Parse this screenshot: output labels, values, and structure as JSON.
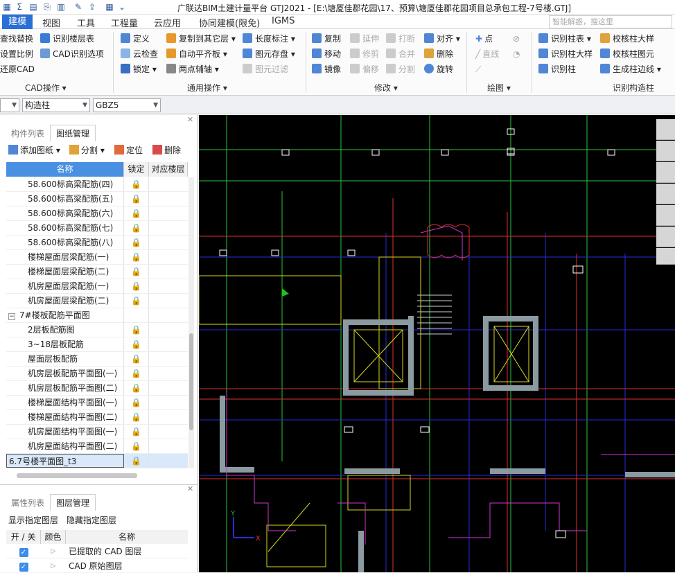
{
  "app": {
    "title": "广联达BIM土建计量平台 GTJ2021 - [E:\\塘厦佳郡花园\\17、预算\\塘厦佳郡花园项目总承包工程-7号楼.GTJ]",
    "search_placeholder": "智能解惑，搜这里"
  },
  "menu": [
    "建模",
    "视图",
    "工具",
    "工程量",
    "云应用",
    "协同建模(限免)",
    "IGMS"
  ],
  "ribbon": {
    "cad_ops": {
      "items": [
        "查找替换",
        "识别楼层表",
        "设置比例",
        "CAD识别选项",
        "还原CAD"
      ],
      "group": "CAD操作"
    },
    "general_ops": {
      "items": [
        "定义",
        "复制到其它层",
        "长度标注",
        "云检查",
        "自动平齐板",
        "图元存盘",
        "锁定",
        "两点辅轴",
        "图元过滤"
      ],
      "group": "通用操作"
    },
    "modify": {
      "items": [
        "复制",
        "延伸",
        "打断",
        "对齐",
        "移动",
        "修剪",
        "合并",
        "删除",
        "镜像",
        "偏移",
        "分割",
        "旋转"
      ],
      "group": "修改"
    },
    "draw": {
      "items": [
        "点",
        "直线"
      ],
      "group": "绘图"
    },
    "recognize": {
      "items": [
        "识别柱表",
        "校核柱大样",
        "识别柱大样",
        "校核柱图元",
        "识别柱",
        "生成柱边线"
      ],
      "group": "识别构造柱"
    }
  },
  "selectors": {
    "floor": "",
    "type": "构造柱",
    "name": "GBZ5"
  },
  "left_panel": {
    "tabs": [
      "构件列表",
      "图纸管理"
    ],
    "toolbar": [
      "添加图纸",
      "分割",
      "定位",
      "删除"
    ],
    "columns": [
      "名称",
      "锁定",
      "对应楼层"
    ],
    "rows": [
      "58.600标高梁配筋(四)",
      "58.600标高梁配筋(五)",
      "58.600标高梁配筋(六)",
      "58.600标高梁配筋(七)",
      "58.600标高梁配筋(八)",
      "楼梯屋面层梁配筋(一)",
      "楼梯屋面层梁配筋(二)",
      "机房屋面层梁配筋(一)",
      "机房屋面层梁配筋(二)"
    ],
    "group_label": "7#楼板配筋平面图",
    "group_rows": [
      "2层板配筋图",
      "3~18层板配筋",
      "屋面层板配筋",
      "机房层板配筋平面图(一)",
      "机房层板配筋平面图(二)",
      "楼梯屋面结构平面图(一)",
      "楼梯屋面结构平面图(二)",
      "机房屋面结构平面图(一)",
      "机房屋面结构平面图(二)"
    ],
    "selected_row": "6.7号楼平面图_t3",
    "bottom_tabs": [
      "属性列表",
      "图层管理"
    ],
    "layer_buttons": [
      "显示指定图层",
      "隐藏指定图层"
    ],
    "layer_columns": [
      "开 / 关",
      "颜色",
      "名称"
    ],
    "layers": [
      "已提取的 CAD 图层",
      "CAD 原始图层"
    ]
  },
  "colors": {
    "accent": "#2b6fd6",
    "canvas": "#000000"
  }
}
